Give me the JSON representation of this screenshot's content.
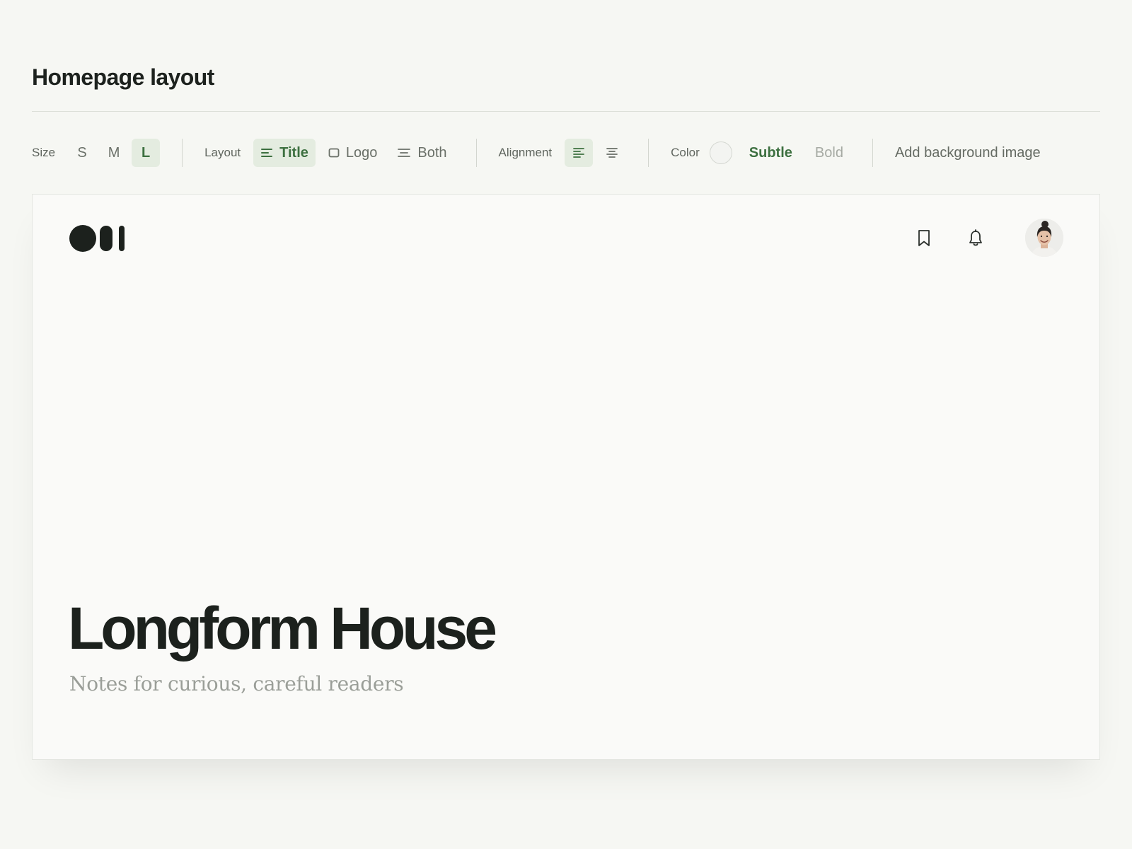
{
  "page": {
    "title": "Homepage layout"
  },
  "toolbar": {
    "size": {
      "label": "Size",
      "options": [
        "S",
        "M",
        "L"
      ],
      "selected": "L"
    },
    "layout": {
      "label": "Layout",
      "options": [
        "Title",
        "Logo",
        "Both"
      ],
      "selected": "Title"
    },
    "alignment": {
      "label": "Alignment",
      "options": [
        "left",
        "center"
      ],
      "selected": "left"
    },
    "color": {
      "label": "Color",
      "swatch": "#f3f4f1",
      "options": [
        "Subtle",
        "Bold"
      ],
      "selected": "Subtle"
    },
    "add_background": "Add background image"
  },
  "preview": {
    "title": "Longform House",
    "subtitle": "Notes for curious, careful readers"
  },
  "colors": {
    "accent": "#3d7040",
    "accent_bg": "#e4ece0",
    "text": "#1d221e",
    "muted": "#6a7068"
  }
}
